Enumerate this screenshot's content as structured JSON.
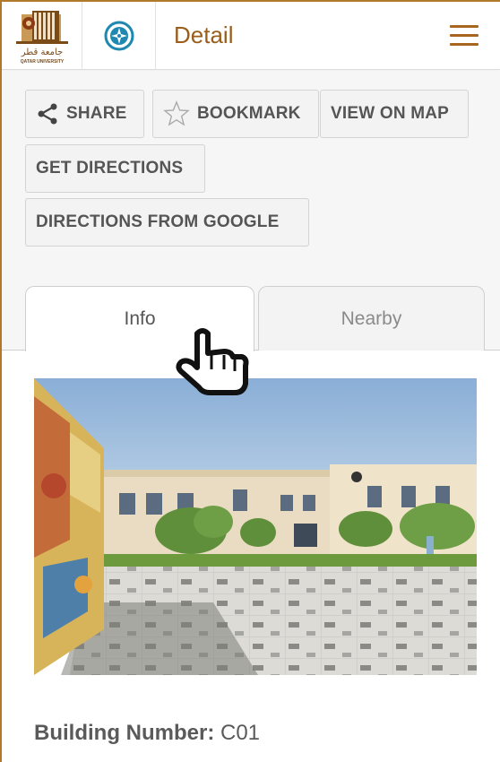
{
  "header": {
    "logo": {
      "arabic_text": "جامعة قطر",
      "english_text": "QATAR UNIVERSITY"
    },
    "compass_icon": "compass-icon",
    "title": "Detail",
    "menu_icon": "hamburger-menu-icon"
  },
  "actions": {
    "share_label": "SHARE",
    "bookmark_label": "BOOKMARK",
    "view_on_map_label": "VIEW ON MAP",
    "get_directions_label": "GET DIRECTIONS",
    "directions_from_google_label": "DIRECTIONS FROM GOOGLE"
  },
  "tabs": [
    {
      "label": "Info",
      "active": true
    },
    {
      "label": "Nearby",
      "active": false
    }
  ],
  "info": {
    "building_number_label": "Building Number:",
    "building_number_value": "C01"
  },
  "colors": {
    "brand": "#9a5d1a",
    "menu": "#a8651f",
    "compass": "#1e88b0",
    "button_bg": "#f3f3f3",
    "button_text": "#555555"
  }
}
